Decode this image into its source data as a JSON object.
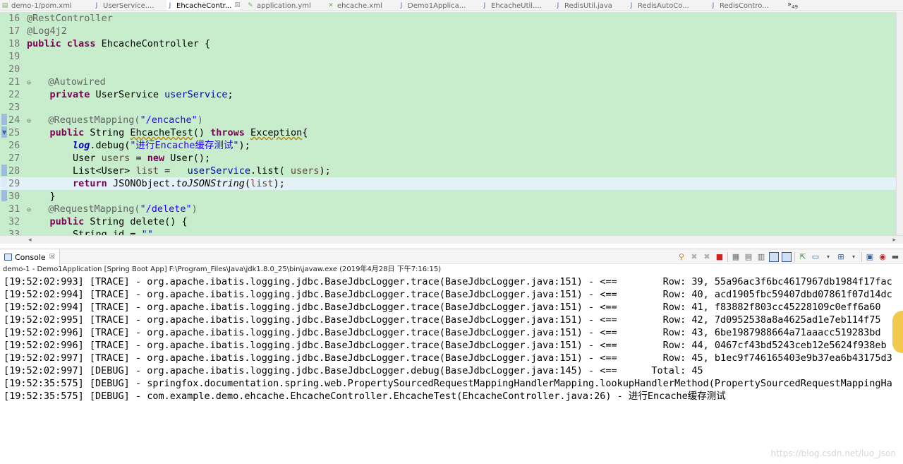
{
  "tabs": [
    {
      "label": "demo-1/pom.xml",
      "icon": "xml-file-icon",
      "active": false
    },
    {
      "label": "UserService....",
      "icon": "java-file-icon",
      "active": false
    },
    {
      "label": "EhcacheContr...",
      "icon": "java-file-icon",
      "active": true,
      "close": "☒"
    },
    {
      "label": "application.yml",
      "icon": "yaml-file-icon",
      "active": false
    },
    {
      "label": "ehcache.xml",
      "icon": "xml-file-icon",
      "active": false
    },
    {
      "label": "Demo1Applica...",
      "icon": "java-file-icon",
      "active": false
    },
    {
      "label": "EhcacheUtil....",
      "icon": "java-file-icon",
      "active": false
    },
    {
      "label": "RedisUtil.java",
      "icon": "java-file-icon",
      "active": false
    },
    {
      "label": "RedisAutoCo...",
      "icon": "java-file-icon",
      "active": false
    },
    {
      "label": "RedisContro...",
      "icon": "java-file-icon",
      "active": false
    }
  ],
  "tab_overflow": {
    "glyph": "»",
    "count": "49"
  },
  "editor": {
    "line_numbers": [
      "16",
      "17",
      "18",
      "19",
      "20",
      "21",
      "22",
      "23",
      "24",
      "25",
      "26",
      "27",
      "28",
      "29",
      "30",
      "31",
      "32",
      "33"
    ],
    "fold_marker": "⊖",
    "current_line": "29"
  },
  "console": {
    "tab_label": "Console",
    "tab_close": "☒",
    "launch_info": "demo-1 - Demo1Application [Spring Boot App] F:\\Program_Files\\Java\\jdk1.8.0_25\\bin\\javaw.exe (2019年4月28日 下午7:16:15)",
    "lines": [
      "[19:52:02:993] [TRACE] - org.apache.ibatis.logging.jdbc.BaseJdbcLogger.trace(BaseJdbcLogger.java:151) - <==        Row: 39, 55a96ac3f6bc4617967db1984f17fac",
      "[19:52:02:994] [TRACE] - org.apache.ibatis.logging.jdbc.BaseJdbcLogger.trace(BaseJdbcLogger.java:151) - <==        Row: 40, acd1905fbc59407dbd07861f07d14dc",
      "[19:52:02:994] [TRACE] - org.apache.ibatis.logging.jdbc.BaseJdbcLogger.trace(BaseJdbcLogger.java:151) - <==        Row: 41, f83882f803cc45228109c0eff6a60",
      "[19:52:02:995] [TRACE] - org.apache.ibatis.logging.jdbc.BaseJdbcLogger.trace(BaseJdbcLogger.java:151) - <==        Row: 42, 7d0952538a8a4625ad1e7eb114f75",
      "[19:52:02:996] [TRACE] - org.apache.ibatis.logging.jdbc.BaseJdbcLogger.trace(BaseJdbcLogger.java:151) - <==        Row: 43, 6be1987988664a71aaacc519283bd",
      "[19:52:02:996] [TRACE] - org.apache.ibatis.logging.jdbc.BaseJdbcLogger.trace(BaseJdbcLogger.java:151) - <==        Row: 44, 0467cf43bd5243ceb12e5624f938eb",
      "[19:52:02:997] [TRACE] - org.apache.ibatis.logging.jdbc.BaseJdbcLogger.trace(BaseJdbcLogger.java:151) - <==        Row: 45, b1ec9f746165403e9b37ea6b43175d3",
      "[19:52:02:997] [DEBUG] - org.apache.ibatis.logging.jdbc.BaseJdbcLogger.debug(BaseJdbcLogger.java:145) - <==      Total: 45",
      "[19:52:35:575] [DEBUG] - springfox.documentation.spring.web.PropertySourcedRequestMappingHandlerMapping.lookupHandlerMethod(PropertySourcedRequestMappingHa",
      "[19:52:35:575] [DEBUG] - com.example.demo.ehcache.EhcacheController.EhcacheTest(EhcacheController.java:26) - 进行Encache缓存测试"
    ]
  },
  "watermark": "https://blog.csdn.net/luo_Json",
  "colors": {
    "editor_bg": "#c7edcc",
    "keyword": "#7f0055",
    "string": "#2a00ff",
    "field": "#0000c0",
    "annotation": "#646464"
  }
}
